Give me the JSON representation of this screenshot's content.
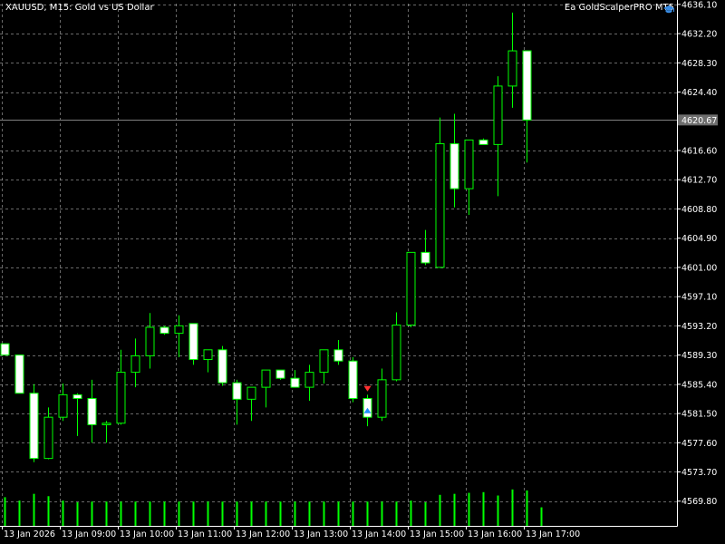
{
  "header": {
    "symbol_title": "XAUUSD, M15:  Gold vs US Dollar",
    "ea_label": "Ea GoldScalperPRO MT5",
    "ea_icon": "graduation-cap-icon"
  },
  "colors": {
    "background": "#000000",
    "grid": "#bfbfbf",
    "axis": "#ffffff",
    "bull_candle_body": "#000000",
    "bear_candle_body": "#ffffff",
    "candle_outline": "#00ff00",
    "volume": "#00ff00",
    "bid_line": "#808080",
    "sell_arrow": "#ff3030",
    "buy_arrow": "#1e90ff"
  },
  "chart_data": {
    "type": "candlestick",
    "symbol": "XAUUSD",
    "timeframe": "M15",
    "y_ticks": [
      "4636.10",
      "4632.20",
      "4628.30",
      "4624.40",
      "4620.67",
      "4616.60",
      "4612.70",
      "4608.80",
      "4604.90",
      "4601.00",
      "4597.10",
      "4593.20",
      "4589.30",
      "4585.40",
      "4581.50",
      "4577.60",
      "4573.70",
      "4569.80"
    ],
    "x_ticks": [
      "13 Jan 2026",
      "13 Jan 09:00",
      "13 Jan 10:00",
      "13 Jan 11:00",
      "13 Jan 12:00",
      "13 Jan 13:00",
      "13 Jan 14:00",
      "13 Jan 15:00",
      "13 Jan 16:00",
      "13 Jan 17:00"
    ],
    "ylim": [
      4566.5,
      4636.2
    ],
    "current_price": 4620.67,
    "grid": true,
    "candles": [
      {
        "o": 4590.8,
        "h": 4590.8,
        "l": 4589.3,
        "c": 4589.3
      },
      {
        "o": 4589.3,
        "h": 4589.3,
        "l": 4585.4,
        "c": 4584.2
      },
      {
        "o": 4584.2,
        "h": 4585.4,
        "l": 4575.0,
        "c": 4575.5
      },
      {
        "o": 4575.5,
        "h": 4582.3,
        "l": 4575.4,
        "c": 4581.0
      },
      {
        "o": 4581.0,
        "h": 4585.5,
        "l": 4580.5,
        "c": 4584.0
      },
      {
        "o": 4584.0,
        "h": 4584.2,
        "l": 4578.5,
        "c": 4583.5
      },
      {
        "o": 4583.5,
        "h": 4586.0,
        "l": 4577.6,
        "c": 4580.0
      },
      {
        "o": 4580.0,
        "h": 4580.5,
        "l": 4577.6,
        "c": 4580.2
      },
      {
        "o": 4580.2,
        "h": 4590.0,
        "l": 4580.0,
        "c": 4587.0
      },
      {
        "o": 4587.0,
        "h": 4591.5,
        "l": 4585.0,
        "c": 4589.2
      },
      {
        "o": 4589.2,
        "h": 4594.9,
        "l": 4587.5,
        "c": 4593.0
      },
      {
        "o": 4593.0,
        "h": 4593.2,
        "l": 4592.0,
        "c": 4592.2
      },
      {
        "o": 4592.2,
        "h": 4594.6,
        "l": 4589.0,
        "c": 4593.2
      },
      {
        "o": 4593.5,
        "h": 4593.5,
        "l": 4588.0,
        "c": 4588.7
      },
      {
        "o": 4588.7,
        "h": 4590.0,
        "l": 4587.0,
        "c": 4590.0
      },
      {
        "o": 4590.0,
        "h": 4590.5,
        "l": 4585.2,
        "c": 4585.6
      },
      {
        "o": 4585.6,
        "h": 4586.0,
        "l": 4580.0,
        "c": 4583.4
      },
      {
        "o": 4583.4,
        "h": 4585.0,
        "l": 4580.5,
        "c": 4585.0
      },
      {
        "o": 4585.0,
        "h": 4587.3,
        "l": 4582.3,
        "c": 4587.3
      },
      {
        "o": 4587.3,
        "h": 4587.3,
        "l": 4586.0,
        "c": 4586.2
      },
      {
        "o": 4586.2,
        "h": 4587.3,
        "l": 4585.0,
        "c": 4585.0
      },
      {
        "o": 4585.0,
        "h": 4588.0,
        "l": 4583.2,
        "c": 4587.0
      },
      {
        "o": 4587.0,
        "h": 4590.0,
        "l": 4585.5,
        "c": 4590.0
      },
      {
        "o": 4590.0,
        "h": 4591.3,
        "l": 4588.0,
        "c": 4588.5
      },
      {
        "o": 4588.5,
        "h": 4589.0,
        "l": 4583.0,
        "c": 4583.5
      },
      {
        "o": 4583.5,
        "h": 4584.0,
        "l": 4579.8,
        "c": 4581.0
      },
      {
        "o": 4581.0,
        "h": 4587.5,
        "l": 4580.5,
        "c": 4586.0
      },
      {
        "o": 4586.0,
        "h": 4595.0,
        "l": 4585.8,
        "c": 4593.3
      },
      {
        "o": 4593.3,
        "h": 4603.0,
        "l": 4593.0,
        "c": 4603.0
      },
      {
        "o": 4603.0,
        "h": 4606.0,
        "l": 4601.3,
        "c": 4601.6
      },
      {
        "o": 4601.0,
        "h": 4621.0,
        "l": 4601.0,
        "c": 4617.5
      },
      {
        "o": 4617.5,
        "h": 4621.5,
        "l": 4609.0,
        "c": 4611.5
      },
      {
        "o": 4611.5,
        "h": 4618.0,
        "l": 4608.0,
        "c": 4618.0
      },
      {
        "o": 4618.0,
        "h": 4618.2,
        "l": 4617.4,
        "c": 4617.4
      },
      {
        "o": 4617.4,
        "h": 4626.5,
        "l": 4610.5,
        "c": 4625.2
      },
      {
        "o": 4625.2,
        "h": 4635.0,
        "l": 4622.3,
        "c": 4629.9
      },
      {
        "o": 4629.9,
        "h": 4629.9,
        "l": 4615.0,
        "c": 4620.67
      }
    ],
    "volumes": [
      0.85,
      0.75,
      0.95,
      0.88,
      0.75,
      0.7,
      0.72,
      0.72,
      0.72,
      0.72,
      0.72,
      0.72,
      0.72,
      0.72,
      0.72,
      0.72,
      0.72,
      0.72,
      0.72,
      0.72,
      0.72,
      0.72,
      0.72,
      0.72,
      0.72,
      0.72,
      0.72,
      0.72,
      0.75,
      0.7,
      0.92,
      0.95,
      0.98,
      1.0,
      0.9,
      1.08,
      1.05,
      0.55
    ],
    "trade_markers": [
      {
        "candle": 25,
        "type": "sell",
        "price": 4584.8
      },
      {
        "candle": 25,
        "type": "buy",
        "price": 4581.9
      }
    ]
  }
}
